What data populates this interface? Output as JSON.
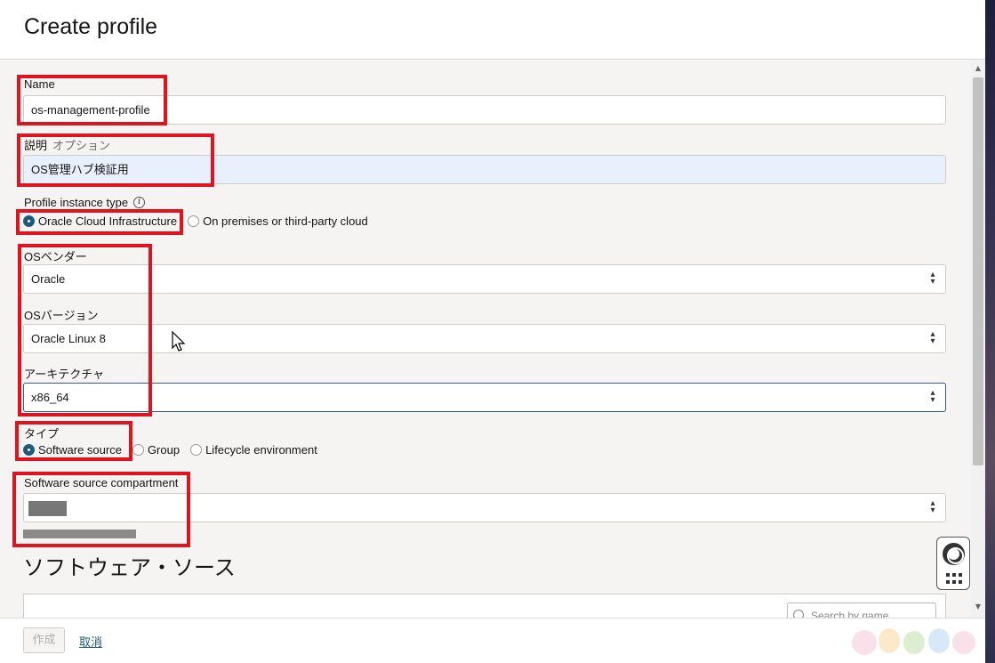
{
  "header": {
    "title": "Create profile"
  },
  "fields": {
    "name": {
      "label": "Name",
      "value": "os-management-profile"
    },
    "description": {
      "label": "説明",
      "optional": "オプション",
      "value": "OS管理ハブ検証用"
    },
    "instance_type": {
      "label": "Profile instance type",
      "options": [
        "Oracle Cloud Infrastructure",
        "On premises or third-party cloud"
      ],
      "selected": "Oracle Cloud Infrastructure"
    },
    "os_vendor": {
      "label": "OSベンダー",
      "value": "Oracle"
    },
    "os_version": {
      "label": "OSバージョン",
      "value": "Oracle Linux 8"
    },
    "architecture": {
      "label": "アーキテクチャ",
      "value": "x86_64"
    },
    "type": {
      "label": "タイプ",
      "options": [
        "Software source",
        "Group",
        "Lifecycle environment"
      ],
      "selected": "Software source"
    },
    "compartment": {
      "label": "Software source compartment",
      "value": ""
    }
  },
  "software_sources": {
    "title": "ソフトウェア・ソース",
    "search_placeholder": "Search by name"
  },
  "footer": {
    "create_label": "作成",
    "cancel_label": "取消"
  },
  "colors": {
    "highlight": "#e0141e",
    "radio_selected": "#1f5a7a",
    "link": "#1f5a7a"
  }
}
